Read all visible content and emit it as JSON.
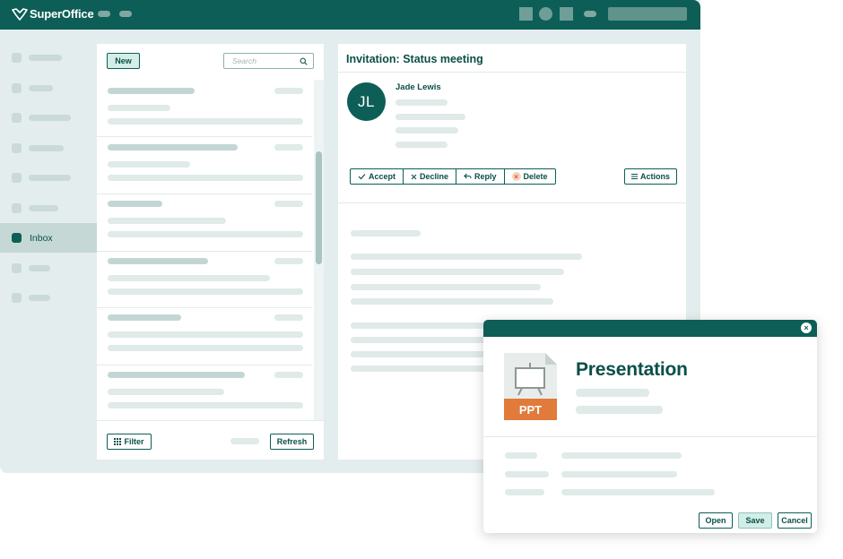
{
  "app": {
    "brand": "SuperOffice"
  },
  "sidebar": {
    "active_label": "Inbox"
  },
  "list": {
    "new_label": "New",
    "search_placeholder": "Search",
    "filter_label": "Filter",
    "refresh_label": "Refresh"
  },
  "mail": {
    "title": "Invitation: Status meeting",
    "sender_initials": "JL",
    "sender_name": "Jade Lewis",
    "actions": {
      "accept": "Accept",
      "decline": "Decline",
      "reply": "Reply",
      "delete": "Delete",
      "more": "Actions"
    }
  },
  "dialog": {
    "title": "Presentation",
    "file_type": "PPT",
    "open_label": "Open",
    "save_label": "Save",
    "cancel_label": "Cancel"
  },
  "colors": {
    "brand": "#0d5e56",
    "file_badge": "#e07b3c",
    "delete_accent": "#d9541e"
  }
}
